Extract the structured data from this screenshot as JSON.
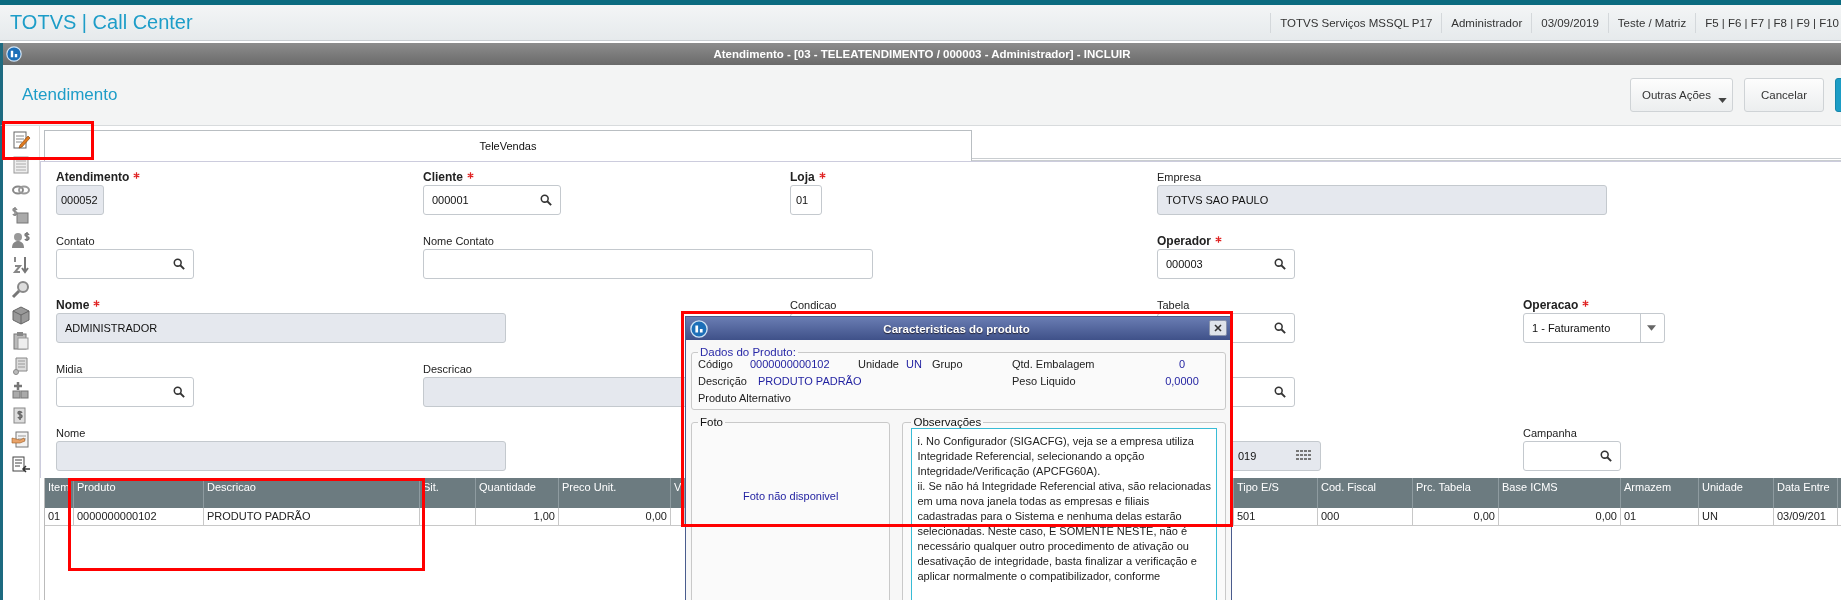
{
  "app_bar": {
    "title": "TOTVS | Call Center",
    "info": [
      "TOTVS Serviços MSSQL P17",
      "Administrador",
      "03/09/2019",
      "Teste / Matriz",
      "F5 | F6 | F7 | F8 | F9 | F10"
    ]
  },
  "window": {
    "title": "Atendimento - [03 - TELEATENDIMENTO / 000003 - Administrador] - INCLUIR"
  },
  "header": {
    "title": "Atendimento",
    "buttons": [
      {
        "kind": "menu",
        "label": "Outras Ações"
      },
      {
        "kind": "plain",
        "label": "Cancelar"
      },
      {
        "kind": "primary"
      }
    ]
  },
  "tabs": [
    {
      "label": "TeleVendas",
      "selected": true
    }
  ],
  "form": {
    "rows": [
      [
        {
          "kind": "readonly-short",
          "label": "Atendimento",
          "required": true,
          "value": "000052"
        },
        {
          "kind": "lookup",
          "label": "Cliente",
          "required": true,
          "value": "000001"
        },
        {
          "kind": "text-short",
          "label": "Loja",
          "required": true,
          "value": "01"
        },
        {
          "kind": "readonly-wide",
          "label": "Empresa",
          "required": false,
          "value": "TOTVS SAO PAULO"
        },
        {
          "kind": "empty"
        }
      ],
      [
        {
          "kind": "lookup",
          "label": "Contato",
          "required": false
        },
        {
          "kind": "text-wide",
          "label": "Nome Contato",
          "required": false
        },
        {
          "kind": "empty"
        },
        {
          "kind": "lookup",
          "label": "Operador",
          "required": true,
          "value": "000003"
        },
        {
          "kind": "empty"
        }
      ],
      [
        {
          "kind": "readonly-wide",
          "label": "Nome",
          "required": true,
          "value": "ADMINISTRADOR"
        },
        {
          "kind": "empty"
        },
        {
          "kind": "text-wide",
          "label": "Condicao",
          "required": false
        },
        {
          "kind": "lookup",
          "label": "Tabela",
          "required": false
        },
        {
          "kind": "select",
          "label": "Operacao",
          "required": true,
          "value": "1 - Faturamento"
        }
      ],
      [
        {
          "kind": "lookup",
          "label": "Midia",
          "required": false
        },
        {
          "kind": "readonly-wide",
          "label": "Descricao",
          "required": false
        },
        {
          "kind": "empty"
        },
        {
          "kind": "lookup"
        },
        {
          "kind": "empty"
        }
      ],
      [
        {
          "kind": "readonly-wide",
          "label": "Nome",
          "required": false
        },
        {
          "kind": "empty"
        },
        {
          "kind": "empty"
        },
        {
          "kind": "date",
          "value": "019"
        },
        {
          "kind": "lookup-narrow",
          "label": "Campanha",
          "required": false
        }
      ]
    ]
  },
  "table": {
    "columns": [
      "Item",
      "Produto",
      "Descricao",
      "Sit.",
      "Quantidade",
      "Preco Unit.",
      "V",
      null,
      "Tipo E/S",
      "Cod. Fiscal",
      "Prc. Tabela",
      "Base ICMS",
      "Armazem",
      "Unidade",
      "Data Entre"
    ],
    "rows": [
      [
        "01",
        "0000000000102",
        "PRODUTO PADRÃO",
        null,
        "1,00",
        "0,00",
        null,
        null,
        "501",
        "000",
        "0,00",
        "0,00",
        "01",
        "UN",
        "03/09/201"
      ]
    ]
  },
  "dialog": {
    "title": "Caracteristicas do produto",
    "product": {
      "legend": "Dados do Produto:",
      "code_label": "Código",
      "code": "0000000000102",
      "unit_label": "Unidade",
      "unit": "UN",
      "group_label": "Grupo",
      "package_label": "Qtd. Embalagem",
      "package": "0",
      "description_label": "Descrição",
      "description": "PRODUTO PADRÃO",
      "weight_label": "Peso Liquido",
      "weight": "0,0000",
      "alternative_label": "Produto Alternativo"
    },
    "photo": {
      "legend": "Foto",
      "message": "Foto não disponivel"
    },
    "notes": {
      "legend": "Observações",
      "text": "i. No Configurador (SIGACFG), veja se a empresa utiliza\nIntegridade Referencial, selecionando a opção\nIntegridade/Verificação (APCFG60A).\nii. Se não há Integridade Referencial ativa, são relacionadas\nem uma nova janela todas as empresas e filiais\ncadastradas para o Sistema e nenhuma delas estarão\nselecionadas. Neste caso, E SOMENTE NESTE, não é\nnecessário qualquer outro procedimento de ativação ou\ndesativação de integridade, basta finalizar a verificação e\naplicar normalmente o compatibilizador, conforme"
    }
  }
}
